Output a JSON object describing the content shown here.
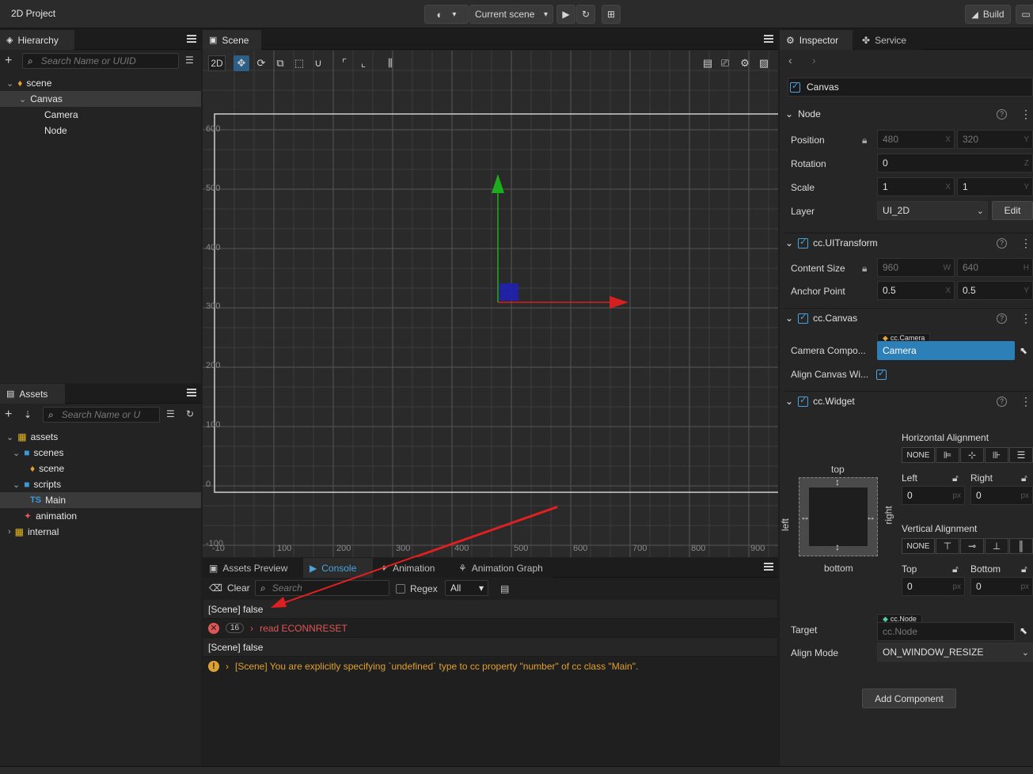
{
  "app": {
    "title": "2D Project",
    "scene_select": "Current scene",
    "build_label": "Build"
  },
  "hierarchy": {
    "tab": "Hierarchy",
    "search_placeholder": "Search Name or UUID",
    "items": [
      {
        "label": "scene"
      },
      {
        "label": "Canvas"
      },
      {
        "label": "Camera"
      },
      {
        "label": "Node"
      }
    ]
  },
  "assets": {
    "tab": "Assets",
    "search_placeholder": "Search Name or U",
    "items": [
      {
        "label": "assets"
      },
      {
        "label": "scenes"
      },
      {
        "label": "scene"
      },
      {
        "label": "scripts"
      },
      {
        "label": "Main",
        "badge": "TS"
      },
      {
        "label": "animation"
      },
      {
        "label": "internal"
      }
    ]
  },
  "scene": {
    "tab": "Scene",
    "mode": "2D",
    "y_ticks": [
      "600",
      "500",
      "400",
      "300",
      "200",
      "100",
      "0",
      "-100"
    ],
    "x_ticks": [
      "-10",
      "100",
      "200",
      "300",
      "400",
      "500",
      "600",
      "700",
      "800",
      "900"
    ]
  },
  "bottom": {
    "tabs": [
      "Assets Preview",
      "Console",
      "Animation",
      "Animation Graph"
    ],
    "clear": "Clear",
    "search_placeholder": "Search",
    "regex": "Regex",
    "filter": "All",
    "lines": [
      {
        "type": "log",
        "text": "[Scene] false"
      },
      {
        "type": "error",
        "count": "16",
        "text": "read ECONNRESET"
      },
      {
        "type": "log",
        "text": "[Scene] false"
      },
      {
        "type": "warn",
        "text": "[Scene] You are explicitly specifying `undefined` type to cc property \"number\" of cc class \"Main\"."
      }
    ]
  },
  "inspector": {
    "tabs": [
      "Inspector",
      "Service"
    ],
    "node_name": "Canvas",
    "node": {
      "title": "Node",
      "position_label": "Position",
      "pos_x": "480",
      "pos_y": "320",
      "rotation_label": "Rotation",
      "rot_z": "0",
      "scale_label": "Scale",
      "scale_x": "1",
      "scale_y": "1",
      "layer_label": "Layer",
      "layer_value": "UI_2D",
      "edit_label": "Edit"
    },
    "uitransform": {
      "title": "cc.UITransform",
      "size_label": "Content Size",
      "w": "960",
      "h": "640",
      "anchor_label": "Anchor Point",
      "ax": "0.5",
      "ay": "0.5"
    },
    "canvas": {
      "title": "cc.Canvas",
      "camera_label": "Camera Compo...",
      "camera_tag": "cc.Camera",
      "camera_value": "Camera",
      "align_label": "Align Canvas Wi..."
    },
    "widget": {
      "title": "cc.Widget",
      "h_align_label": "Horizontal Alignment",
      "none": "NONE",
      "left_label": "Left",
      "left_val": "0",
      "right_label": "Right",
      "right_val": "0",
      "v_align_label": "Vertical Alignment",
      "top_label": "Top",
      "top_val": "0",
      "bottom_label": "Bottom",
      "bottom_val": "0",
      "diag_top": "top",
      "diag_bottom": "bottom",
      "diag_left": "left",
      "diag_right": "right",
      "unit": "px",
      "target_label": "Target",
      "target_tag": "cc.Node",
      "target_value": "cc.Node",
      "align_mode_label": "Align Mode",
      "align_mode_value": "ON_WINDOW_RESIZE"
    },
    "add_component": "Add Component"
  },
  "colors": {
    "accent": "#2d7fb8",
    "error": "#e05555",
    "warn": "#e0a030",
    "axis_x": "#d62020",
    "axis_y": "#1cae1c",
    "node_box": "#2020b0"
  }
}
